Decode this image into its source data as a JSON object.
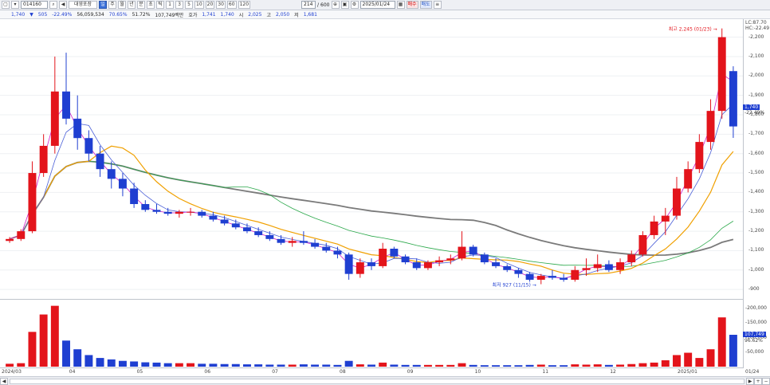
{
  "toolbar": {
    "code": "014160",
    "name": "대영포장",
    "period_buttons": [
      "일",
      "주",
      "월",
      "년",
      "분",
      "초",
      "틱"
    ],
    "minute_buttons": [
      "1",
      "3",
      "5",
      "10",
      "20",
      "30",
      "60",
      "120"
    ],
    "count": "214",
    "count_total": "600",
    "date": "2025/01/24",
    "buy_label": "매수",
    "sell_label": "매도"
  },
  "quote": {
    "price": "1,740",
    "change": "505",
    "change_pct": "-22.49%",
    "volume": "56,059,534",
    "ratio": "70.65%",
    "ratio2": "51.72%",
    "amount": "107,749백만",
    "ask_label": "호가",
    "ask": "1,741",
    "bid": "1,740",
    "open_label": "시",
    "open": "2,025",
    "high_label": "고",
    "high": "2,050",
    "low_label": "저",
    "low": "1,681"
  },
  "legend": {
    "lc": "LC:87.70",
    "hc": "HC:-22.49"
  },
  "annotations": {
    "high": "최고 2,245 (01/23)",
    "low": "최저 927 (11/15)"
  },
  "price_axis": [
    "2,200",
    "2,100",
    "2,000",
    "1,900",
    "1,800",
    "1,700",
    "1,600",
    "1,500",
    "1,400",
    "1,300",
    "1,200",
    "1,100",
    "1,000",
    "900"
  ],
  "current_price_tag": "1,740",
  "current_pct_tag": "-22.49%",
  "volume_axis": [
    "200,000",
    "150,000",
    "100,000",
    "50,000"
  ],
  "volume_tag": "107,749",
  "volume_pct_tag": "96.62%",
  "date_axis": [
    "2024/03",
    "04",
    "05",
    "06",
    "07",
    "08",
    "09",
    "10",
    "11",
    "12",
    "2025/01",
    "01/24"
  ],
  "colors": {
    "up": "#e3141b",
    "down": "#1f3fd1",
    "ma5": "#d01ec8",
    "ma10": "#4a5fd8",
    "ma20": "#f0a000",
    "ma60": "#2aa84a",
    "ma120": "#7a7a7a"
  },
  "chart_data": {
    "type": "candlestick",
    "ylim": [
      880,
      2260
    ],
    "candles": [
      [
        1150,
        1170,
        1140,
        1160
      ],
      [
        1160,
        1210,
        1150,
        1200
      ],
      [
        1200,
        1560,
        1190,
        1500
      ],
      [
        1500,
        1700,
        1480,
        1640
      ],
      [
        1640,
        2100,
        1600,
        1920
      ],
      [
        1920,
        2120,
        1750,
        1780
      ],
      [
        1780,
        1900,
        1620,
        1680
      ],
      [
        1680,
        1720,
        1560,
        1600
      ],
      [
        1600,
        1640,
        1480,
        1520
      ],
      [
        1520,
        1560,
        1420,
        1470
      ],
      [
        1470,
        1500,
        1380,
        1420
      ],
      [
        1420,
        1450,
        1320,
        1340
      ],
      [
        1340,
        1360,
        1300,
        1310
      ],
      [
        1310,
        1340,
        1290,
        1300
      ],
      [
        1300,
        1320,
        1280,
        1290
      ],
      [
        1290,
        1310,
        1270,
        1300
      ],
      [
        1300,
        1320,
        1280,
        1300
      ],
      [
        1300,
        1310,
        1270,
        1280
      ],
      [
        1280,
        1300,
        1250,
        1260
      ],
      [
        1260,
        1280,
        1230,
        1240
      ],
      [
        1240,
        1260,
        1210,
        1220
      ],
      [
        1220,
        1240,
        1190,
        1200
      ],
      [
        1200,
        1220,
        1170,
        1180
      ],
      [
        1180,
        1200,
        1150,
        1160
      ],
      [
        1160,
        1180,
        1130,
        1140
      ],
      [
        1140,
        1170,
        1120,
        1150
      ],
      [
        1150,
        1200,
        1130,
        1140
      ],
      [
        1140,
        1160,
        1110,
        1120
      ],
      [
        1120,
        1140,
        1090,
        1100
      ],
      [
        1100,
        1120,
        1060,
        1080
      ],
      [
        1080,
        1090,
        950,
        980
      ],
      [
        980,
        1060,
        960,
        1040
      ],
      [
        1040,
        1060,
        1000,
        1020
      ],
      [
        1020,
        1140,
        1010,
        1110
      ],
      [
        1110,
        1120,
        1060,
        1070
      ],
      [
        1070,
        1080,
        1030,
        1040
      ],
      [
        1040,
        1060,
        1000,
        1010
      ],
      [
        1010,
        1050,
        1000,
        1040
      ],
      [
        1040,
        1070,
        1020,
        1050
      ],
      [
        1050,
        1080,
        1030,
        1060
      ],
      [
        1060,
        1200,
        1050,
        1120
      ],
      [
        1120,
        1130,
        1070,
        1080
      ],
      [
        1080,
        1090,
        1030,
        1040
      ],
      [
        1040,
        1060,
        1010,
        1020
      ],
      [
        1020,
        1030,
        990,
        1000
      ],
      [
        1000,
        1010,
        960,
        980
      ],
      [
        980,
        990,
        940,
        950
      ],
      [
        950,
        980,
        927,
        970
      ],
      [
        970,
        1000,
        950,
        960
      ],
      [
        960,
        980,
        940,
        950
      ],
      [
        950,
        1020,
        940,
        1000
      ],
      [
        1000,
        1060,
        970,
        1010
      ],
      [
        1010,
        1080,
        990,
        1030
      ],
      [
        1030,
        1050,
        990,
        1000
      ],
      [
        1000,
        1060,
        980,
        1040
      ],
      [
        1040,
        1100,
        1020,
        1080
      ],
      [
        1080,
        1200,
        1070,
        1180
      ],
      [
        1180,
        1280,
        1160,
        1250
      ],
      [
        1250,
        1320,
        1180,
        1280
      ],
      [
        1280,
        1480,
        1260,
        1420
      ],
      [
        1420,
        1560,
        1400,
        1520
      ],
      [
        1520,
        1700,
        1500,
        1660
      ],
      [
        1660,
        1880,
        1620,
        1820
      ],
      [
        1820,
        2245,
        1780,
        2200
      ],
      [
        2025,
        2050,
        1681,
        1740
      ]
    ],
    "volume": [
      10,
      12,
      120,
      180,
      210,
      90,
      60,
      40,
      30,
      25,
      20,
      18,
      15,
      14,
      12,
      12,
      12,
      10,
      10,
      9,
      9,
      8,
      8,
      7,
      7,
      7,
      8,
      7,
      7,
      6,
      20,
      8,
      7,
      14,
      7,
      6,
      6,
      6,
      6,
      6,
      12,
      6,
      5,
      5,
      5,
      5,
      6,
      7,
      5,
      5,
      8,
      7,
      8,
      6,
      7,
      9,
      12,
      14,
      22,
      40,
      48,
      30,
      60,
      170,
      110
    ],
    "ylabel_right": "price"
  }
}
